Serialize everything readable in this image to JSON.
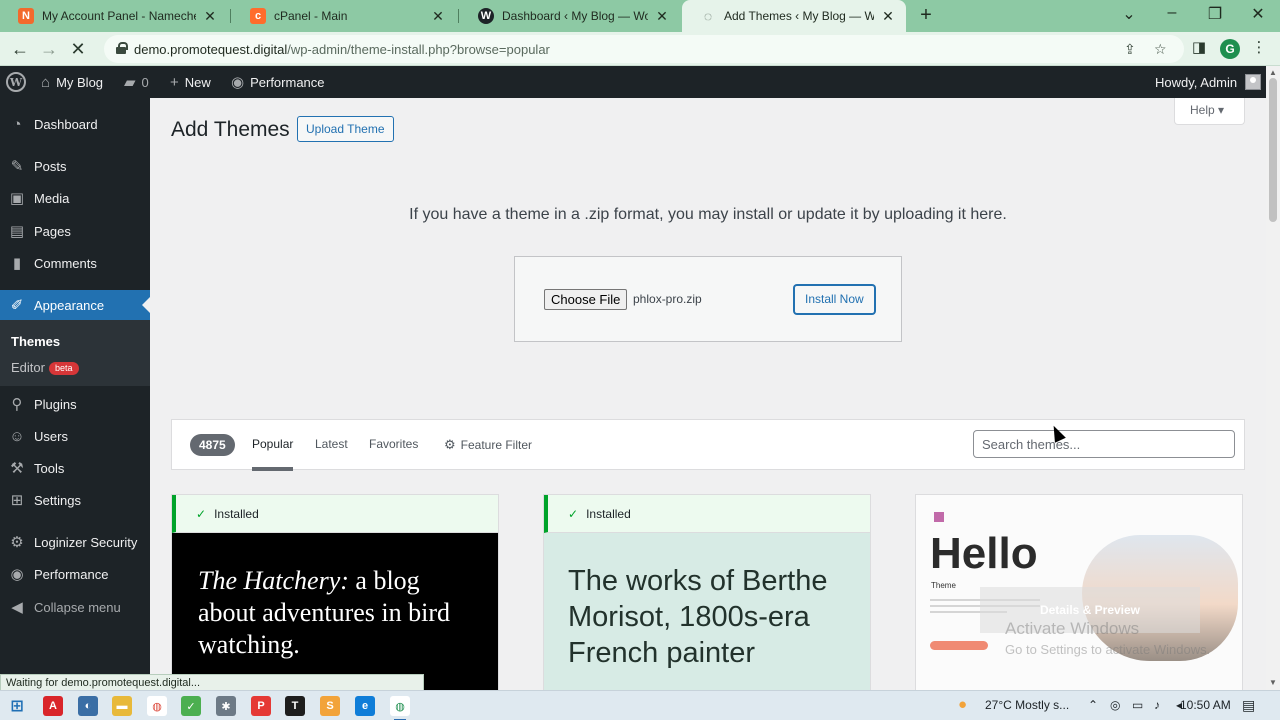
{
  "browser": {
    "tabs": [
      {
        "label": "My Account Panel - Namecheap",
        "icon": "namecheap-icon",
        "icon_glyph": "N",
        "color": "#f26a2c"
      },
      {
        "label": "cPanel - Main",
        "icon": "cpanel-icon",
        "icon_glyph": "c",
        "color": "#ff6c2c"
      },
      {
        "label": "Dashboard ‹ My Blog — WordPress",
        "icon": "wordpress-icon",
        "icon_glyph": "W",
        "color": "#1d2327"
      },
      {
        "label": "Add Themes ‹ My Blog — WordPress",
        "icon": "loading-spinner-icon",
        "icon_glyph": "◌",
        "color": "#5a6a5e"
      }
    ],
    "url_host": "demo.promotequest.digital",
    "url_path": "/wp-admin/theme-install.php?browse=popular",
    "profile_initial": "G",
    "status_text": "Waiting for demo.promotequest.digital..."
  },
  "adminbar": {
    "site_name": "My Blog",
    "comments_count": "0",
    "new_label": "New",
    "performance_label": "Performance",
    "howdy": "Howdy, Admin"
  },
  "sidebar": {
    "items": [
      {
        "label": "Dashboard",
        "icon": "dashboard-icon",
        "glyph": "◔"
      },
      {
        "label": "Posts",
        "icon": "pushpin-icon",
        "glyph": "✎"
      },
      {
        "label": "Media",
        "icon": "media-icon",
        "glyph": "▣"
      },
      {
        "label": "Pages",
        "icon": "pages-icon",
        "glyph": "▤"
      },
      {
        "label": "Comments",
        "icon": "comments-icon",
        "glyph": "▮"
      },
      {
        "label": "Appearance",
        "icon": "paintbrush-icon",
        "glyph": "✐"
      },
      {
        "label": "Plugins",
        "icon": "plugin-icon",
        "glyph": "⚲"
      },
      {
        "label": "Users",
        "icon": "users-icon",
        "glyph": "☺"
      },
      {
        "label": "Tools",
        "icon": "wrench-icon",
        "glyph": "⚒"
      },
      {
        "label": "Settings",
        "icon": "settings-icon",
        "glyph": "⊞"
      },
      {
        "label": "Loginizer Security",
        "icon": "gear-icon",
        "glyph": "⚙"
      },
      {
        "label": "Performance",
        "icon": "performance-icon",
        "glyph": "◉"
      }
    ],
    "submenu": {
      "themes": "Themes",
      "editor": "Editor",
      "beta": "beta"
    },
    "collapse": "Collapse menu"
  },
  "main": {
    "title": "Add Themes",
    "upload_theme": "Upload Theme",
    "help": "Help",
    "upload_description": "If you have a theme in a .zip format, you may install or update it by uploading it here.",
    "choose_file": "Choose File",
    "file_name": "phlox-pro.zip",
    "install_now": "Install Now",
    "filter": {
      "count": "4875",
      "popular": "Popular",
      "latest": "Latest",
      "favorites": "Favorites",
      "feature_filter": "Feature Filter",
      "search_placeholder": "Search themes..."
    },
    "themes": [
      {
        "installed": "Installed",
        "preview_italic": "The Hatchery:",
        "preview_rest": " a blog about adventures in bird watching."
      },
      {
        "installed": "Installed",
        "preview": "The works of Berthe Morisot, 1800s-era French painter"
      },
      {
        "preview_title": "Hello",
        "preview_sub": "Theme",
        "overlay": "Details & Preview"
      }
    ]
  },
  "watermark": {
    "line1": "Activate Windows",
    "line2": "Go to Settings to activate Windows."
  },
  "taskbar": {
    "weather": "27°C  Mostly s...",
    "time": "10:50 AM"
  },
  "colors": {
    "accent": "#2271b1",
    "admin_dark": "#1d2327",
    "installed_green": "#00a32a"
  }
}
